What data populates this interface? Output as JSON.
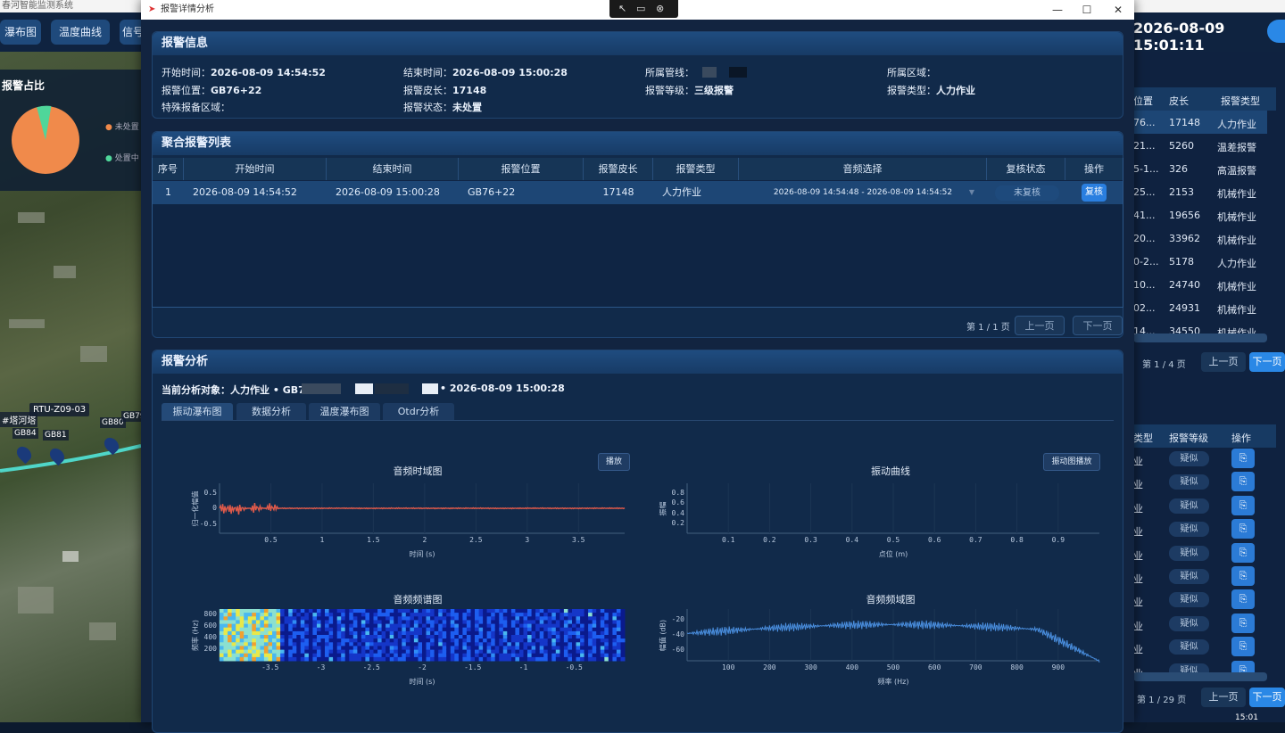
{
  "bg_app": {
    "title": "春河智能监测系统",
    "tabs": [
      "瀑布图",
      "温度曲线",
      "信号"
    ],
    "pie_title": "报警占比",
    "pie_legend": [
      "未处置",
      "处置中"
    ],
    "time": "2026-08-09  15:01:11",
    "map_labels": [
      "#塔河塔",
      "RTU-Z09-03",
      "GB84",
      "GB81",
      "GB80",
      "GB79"
    ],
    "right_table1": {
      "headers": [
        "位置",
        "皮长",
        "报警类型"
      ],
      "rows": [
        [
          "76...",
          "17148",
          "人力作业"
        ],
        [
          "21...",
          "5260",
          "温差报警"
        ],
        [
          "5-1...",
          "326",
          "高温报警"
        ],
        [
          "25...",
          "2153",
          "机械作业"
        ],
        [
          "41...",
          "19656",
          "机械作业"
        ],
        [
          "20...",
          "33962",
          "机械作业"
        ],
        [
          "0-2...",
          "5178",
          "人力作业"
        ],
        [
          "10...",
          "24740",
          "机械作业"
        ],
        [
          "02...",
          "24931",
          "机械作业"
        ],
        [
          "14...",
          "34550",
          "机械作业"
        ]
      ],
      "pager": "第 1 / 4 页",
      "prev": "上一页",
      "next": "下一页"
    },
    "right_table2": {
      "headers": [
        "类型",
        "报警等级",
        "操作"
      ],
      "rows": [
        [
          "业",
          "疑似"
        ],
        [
          "业",
          "疑似"
        ],
        [
          "业",
          "疑似"
        ],
        [
          "业",
          "疑似"
        ],
        [
          "业",
          "疑似"
        ],
        [
          "业",
          "疑似"
        ],
        [
          "业",
          "疑似"
        ],
        [
          "业",
          "疑似"
        ],
        [
          "业",
          "疑似"
        ],
        [
          "业",
          "疑似"
        ]
      ],
      "pager": "第 1 / 29 页",
      "prev": "上一页",
      "next": "下一页"
    },
    "clock": "15:01"
  },
  "modal": {
    "title": "报警详情分析",
    "info_panel": {
      "title": "报警信息",
      "fields": [
        {
          "label": "开始时间：",
          "value": "2026-08-09 14:54:52"
        },
        {
          "label": "结束时间：",
          "value": "2026-08-09 15:00:28"
        },
        {
          "label": "所属管线：",
          "value": ""
        },
        {
          "label": "所属区域：",
          "value": ""
        },
        {
          "label": "报警位置：",
          "value": "GB76+22"
        },
        {
          "label": "报警皮长：",
          "value": "17148"
        },
        {
          "label": "报警等级：",
          "value": "三级报警"
        },
        {
          "label": "报警类型：",
          "value": "人力作业"
        },
        {
          "label": "特殊报备区域：",
          "value": ""
        },
        {
          "label": "报警状态：",
          "value": "未处置"
        }
      ]
    },
    "list_panel": {
      "title": "聚合报警列表",
      "headers": [
        "序号",
        "开始时间",
        "结束时间",
        "报警位置",
        "报警皮长",
        "报警类型",
        "音频选择",
        "复核状态",
        "操作"
      ],
      "rows": [
        {
          "idx": "1",
          "start": "2026-08-09 14:54:52",
          "end": "2026-08-09 15:00:28",
          "pos": "GB76+22",
          "len": "17148",
          "type": "人力作业",
          "audio": "2026-08-09 14:54:48 - 2026-08-09 14:54:52",
          "status": "未复核",
          "op": "复核"
        }
      ],
      "pager": "第 1 / 1 页",
      "prev": "上一页",
      "next": "下一页"
    },
    "analysis_panel": {
      "title": "报警分析",
      "target_label": "当前分析对象：",
      "target_prefix": "人力作业 • GB7",
      "target_suffix": "• 2026-08-09 15:00:28",
      "tabs": [
        "振动瀑布图",
        "数据分析",
        "温度瀑布图",
        "Otdr分析"
      ]
    }
  },
  "chart_data": [
    {
      "type": "line",
      "title": "音频时域图",
      "xlabel": "时间 (s)",
      "ylabel": "归一化幅值",
      "xticks": [
        "0.5",
        "1",
        "1.5",
        "2",
        "2.5",
        "3",
        "3.5"
      ],
      "yticks": [
        "0.5",
        "0",
        "-0.5"
      ],
      "xlim": [
        0,
        3.95
      ],
      "ylim": [
        -0.8,
        0.8
      ],
      "button": "播放",
      "color": "#e05a4a"
    },
    {
      "type": "line",
      "title": "振动曲线",
      "xlabel": "点位 (m)",
      "ylabel": "振幅",
      "xticks": [
        "0.1",
        "0.2",
        "0.3",
        "0.4",
        "0.5",
        "0.6",
        "0.7",
        "0.8",
        "0.9"
      ],
      "yticks": [
        "0.8",
        "0.6",
        "0.4",
        "0.2"
      ],
      "xlim": [
        0,
        1
      ],
      "ylim": [
        0,
        1
      ],
      "button": "振动图播放"
    },
    {
      "type": "heatmap",
      "title": "音频频谱图",
      "xlabel": "时间 (s)",
      "ylabel": "频率 (Hz)",
      "xticks": [
        "-3.5",
        "-3",
        "-2.5",
        "-2",
        "-1.5",
        "-1",
        "-0.5"
      ],
      "yticks": [
        "800",
        "600",
        "400",
        "200"
      ],
      "xlim": [
        -4,
        0
      ],
      "ylim": [
        0,
        900
      ]
    },
    {
      "type": "line",
      "title": "音频频域图",
      "xlabel": "频率 (Hz)",
      "ylabel": "幅值 (dB)",
      "xticks": [
        "100",
        "200",
        "300",
        "400",
        "500",
        "600",
        "700",
        "800",
        "900"
      ],
      "yticks": [
        "-20",
        "-40",
        "-60"
      ],
      "xlim": [
        0,
        1000
      ],
      "ylim": [
        -75,
        -5
      ],
      "color": "#4a8fe0"
    }
  ]
}
